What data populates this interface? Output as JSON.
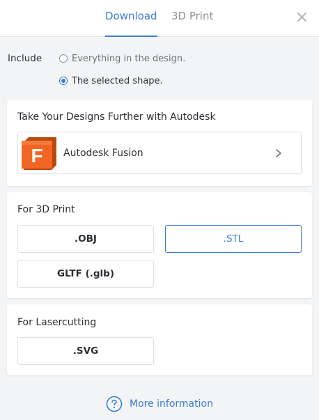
{
  "tabs": [
    {
      "label": "Download",
      "active": true
    },
    {
      "label": "3D Print",
      "active": false
    }
  ],
  "icons": {
    "close": "close-icon",
    "fusion": "autodesk-fusion-logo-icon",
    "chevron": "chevron-right-icon",
    "help": "question-circle-icon"
  },
  "include": {
    "label": "Include",
    "options": [
      {
        "label": "Everything in the design.",
        "selected": false
      },
      {
        "label": "The selected shape.",
        "selected": true
      }
    ]
  },
  "autodesk_card": {
    "title": "Take Your Designs Further with Autodesk",
    "fusion_label": "Autodesk Fusion",
    "logo_letter": "F"
  },
  "print_card": {
    "title": "For 3D Print",
    "buttons": [
      {
        "label": ".OBJ",
        "selected": false
      },
      {
        "label": ".STL",
        "selected": true
      },
      {
        "label": "GLTF (.glb)",
        "selected": false
      }
    ]
  },
  "laser_card": {
    "title": "For Lasercutting",
    "buttons": [
      {
        "label": ".SVG",
        "selected": false
      }
    ]
  },
  "footer": {
    "more_info_label": "More information"
  },
  "colors": {
    "accent": "#3a7bd5",
    "fusion_orange": "#f26522",
    "background": "#f3f4f6"
  }
}
